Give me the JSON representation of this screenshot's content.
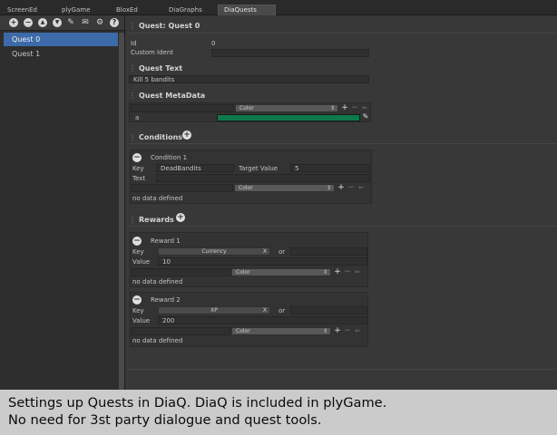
{
  "tabs": [
    "ScreenEd",
    "plyGame",
    "BloxEd",
    "DiaGraphs",
    "DiaQuests"
  ],
  "toolbar": {
    "icons": [
      "add-icon",
      "remove-icon",
      "up-icon",
      "down-icon",
      "edit-icon",
      "chat-icon",
      "gear-icon",
      "help-icon"
    ],
    "glyphs": {
      "add": "+",
      "remove": "−",
      "up": "▲",
      "down": "▼",
      "edit": "✎",
      "chat": "✉",
      "gear": "⚙",
      "help": "?"
    }
  },
  "quest_list": [
    "Quest 0",
    "Quest 1"
  ],
  "quest": {
    "header": "Quest: Quest 0",
    "id_label": "Id",
    "id_value": "0",
    "custom_ident_label": "Custom Ident",
    "custom_ident_value": ""
  },
  "quest_text": {
    "header": "Quest Text",
    "value": "Kill 5 bandits"
  },
  "metadata": {
    "header": "Quest MetaData",
    "type": "Color",
    "key": "a",
    "color": "#0e7a4c"
  },
  "conditions": {
    "header": "Conditions",
    "items": [
      {
        "title": "Condition 1",
        "key_label": "Key",
        "key_value": "DeadBandits",
        "target_label": "Target Value",
        "target_value": "5",
        "text_label": "Text",
        "text_value": "",
        "type": "Color",
        "no_data": "no data defined"
      }
    ]
  },
  "rewards": {
    "header": "Rewards",
    "items": [
      {
        "title": "Reward 1",
        "key_label": "Key",
        "key_value": "Currency",
        "or": "or",
        "value_label": "Value",
        "value": "10",
        "type": "Color",
        "no_data": "no data defined"
      },
      {
        "title": "Reward 2",
        "key_label": "Key",
        "key_value": "XP",
        "or": "or",
        "value_label": "Value",
        "value": "200",
        "type": "Color",
        "no_data": "no data defined"
      }
    ]
  },
  "caption": {
    "line1": "Settings up Quests in DiaQ. DiaQ is included in plyGame.",
    "line2": "No need for 3st party dialogue and quest tools."
  }
}
